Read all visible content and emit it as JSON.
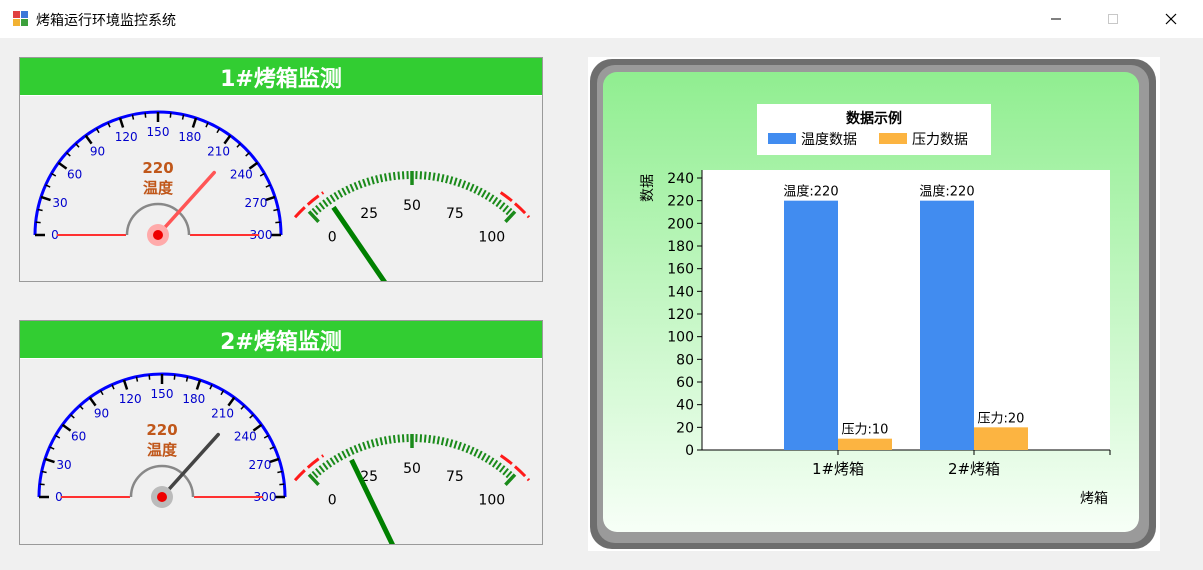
{
  "window": {
    "title": "烤箱运行环境监控系统"
  },
  "panels": [
    {
      "header": "1#烤箱监测",
      "temp_gauge": {
        "value": 220,
        "label": "温度",
        "ticks": [
          "0",
          "30",
          "60",
          "90",
          "120",
          "150",
          "180",
          "210",
          "240",
          "270",
          "300"
        ],
        "needle_color": "#ff5555"
      },
      "pressure_gauge": {
        "value": 10,
        "ticks": [
          "0",
          "25",
          "50",
          "75",
          "100"
        ]
      }
    },
    {
      "header": "2#烤箱监测",
      "temp_gauge": {
        "value": 220,
        "label": "温度",
        "ticks": [
          "0",
          "30",
          "60",
          "90",
          "120",
          "150",
          "180",
          "210",
          "240",
          "270",
          "300"
        ],
        "needle_color": "#444444"
      },
      "pressure_gauge": {
        "value": 20,
        "ticks": [
          "0",
          "25",
          "50",
          "75",
          "100"
        ]
      }
    }
  ],
  "chart_data": {
    "type": "bar",
    "legend_title": "数据示例",
    "categories": [
      "1#烤箱",
      "2#烤箱"
    ],
    "series": [
      {
        "name": "温度数据",
        "values": [
          220,
          220
        ],
        "color": "#418cf0",
        "label_prefix": "温度"
      },
      {
        "name": "压力数据",
        "values": [
          10,
          20
        ],
        "color": "#fcb441",
        "label_prefix": "压力"
      }
    ],
    "xlabel": "烤箱",
    "ylabel": "数据",
    "ylim": [
      0,
      250
    ],
    "yticks": [
      0,
      20,
      40,
      60,
      80,
      100,
      120,
      140,
      160,
      180,
      200,
      220,
      240
    ],
    "legend_position": "top-center",
    "grid": false
  }
}
